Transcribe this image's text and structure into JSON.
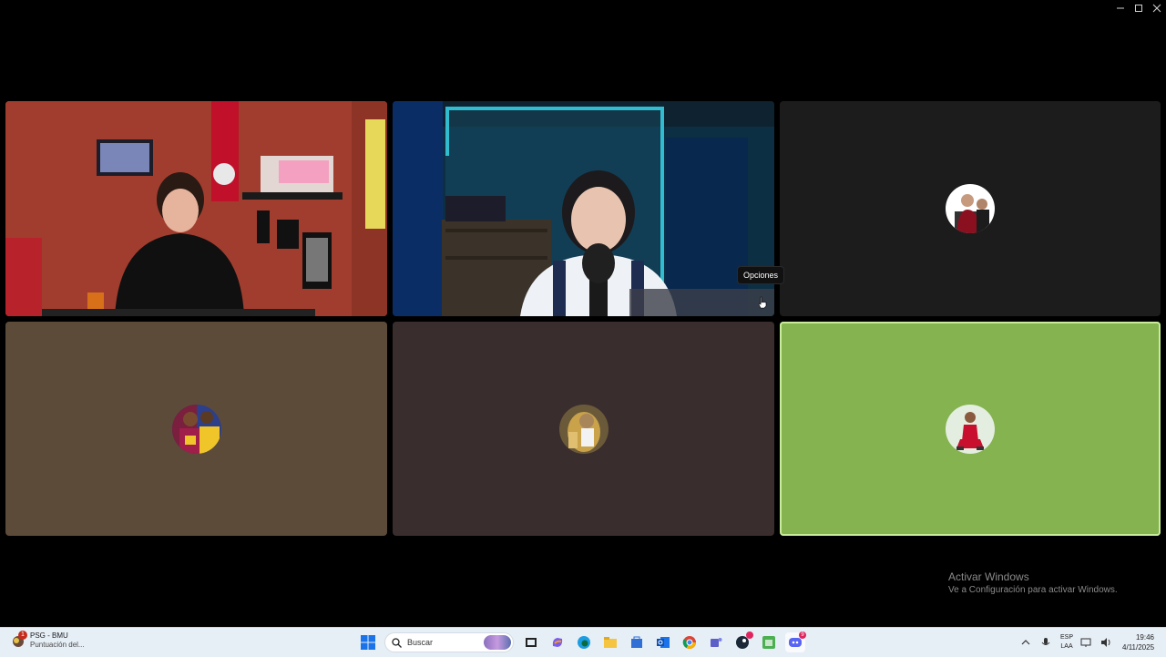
{
  "window": {
    "minimize_icon": "minimize-icon",
    "maximize_icon": "maximize-icon",
    "close_icon": "close-icon"
  },
  "participants": [
    {
      "id": "p1",
      "kind": "video",
      "speaking": false
    },
    {
      "id": "p2",
      "kind": "video",
      "speaking": false
    },
    {
      "id": "p3",
      "kind": "avatar",
      "background": "#1c1c1c",
      "speaking": false
    },
    {
      "id": "p4",
      "kind": "avatar",
      "background": "#5d4b39",
      "speaking": false
    },
    {
      "id": "p5",
      "kind": "avatar",
      "background": "#3a2d2d",
      "speaking": false
    },
    {
      "id": "p6",
      "kind": "avatar",
      "background": "#84b34f",
      "speaking": true
    }
  ],
  "tooltip": {
    "text": "Opciones"
  },
  "watermark": {
    "title": "Activar Windows",
    "subtitle": "Ve a Configuración para activar Windows."
  },
  "taskbar": {
    "news": {
      "title": "PSG - BMU",
      "subtitle": "Puntuación del...",
      "badge": "1"
    },
    "search": {
      "placeholder": "Buscar"
    },
    "apps": [
      "task-view-icon",
      "copilot-icon",
      "edge-icon",
      "file-explorer-icon",
      "store-icon",
      "outlook-icon",
      "chrome-icon",
      "teams-icon",
      "steam-icon",
      "android-icon",
      "discord-icon"
    ],
    "discord_badge": "9",
    "tray": {
      "lang_line1": "ESP",
      "lang_line2": "LAA",
      "time": "19:46",
      "date": "4/11/2025"
    }
  },
  "colors": {
    "speaking_border": "#c8ec9c",
    "taskbar_bg": "#e6eef6"
  }
}
